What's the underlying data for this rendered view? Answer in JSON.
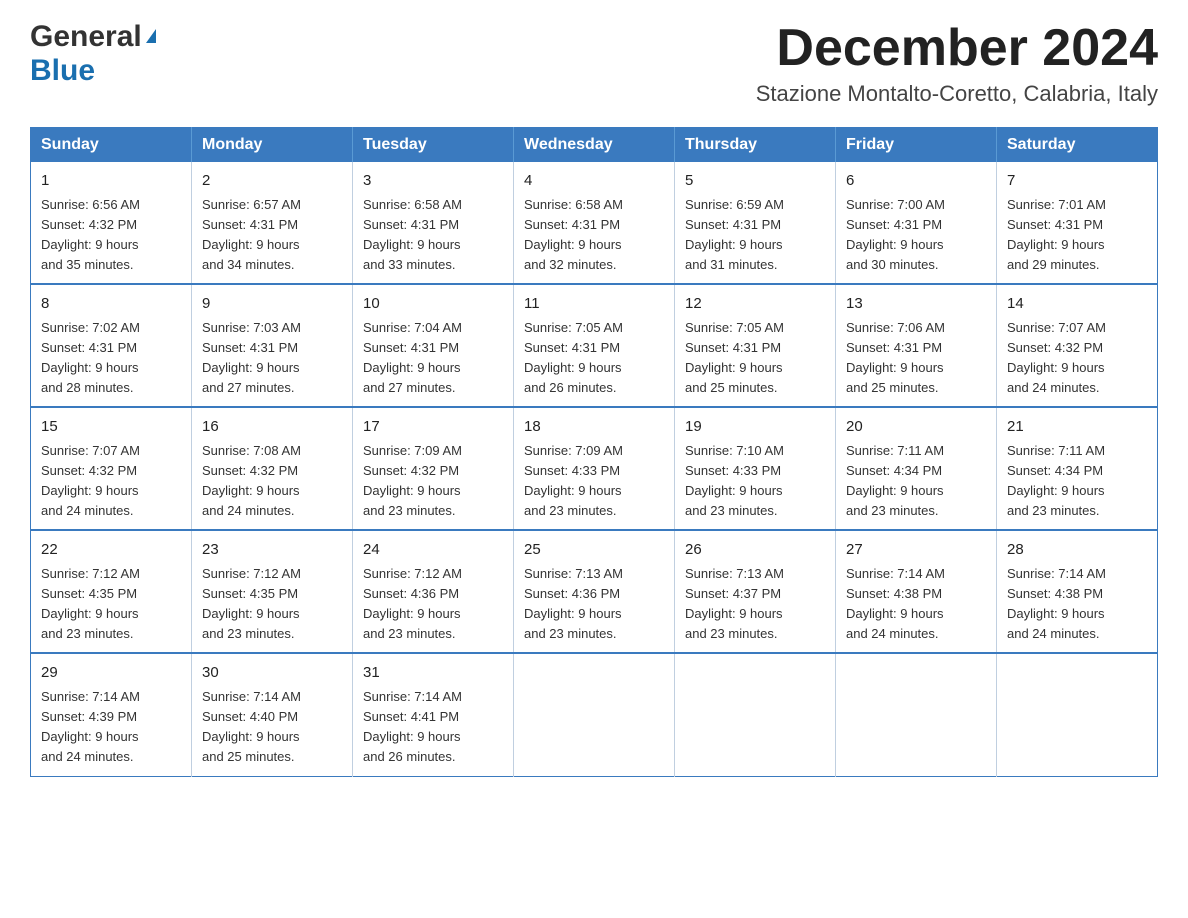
{
  "header": {
    "logo_line1": "General",
    "logo_line2": "Blue",
    "month_title": "December 2024",
    "location": "Stazione Montalto-Coretto, Calabria, Italy"
  },
  "days_of_week": [
    "Sunday",
    "Monday",
    "Tuesday",
    "Wednesday",
    "Thursday",
    "Friday",
    "Saturday"
  ],
  "weeks": [
    [
      {
        "day": "1",
        "sunrise": "6:56 AM",
        "sunset": "4:32 PM",
        "daylight": "9 hours and 35 minutes."
      },
      {
        "day": "2",
        "sunrise": "6:57 AM",
        "sunset": "4:31 PM",
        "daylight": "9 hours and 34 minutes."
      },
      {
        "day": "3",
        "sunrise": "6:58 AM",
        "sunset": "4:31 PM",
        "daylight": "9 hours and 33 minutes."
      },
      {
        "day": "4",
        "sunrise": "6:58 AM",
        "sunset": "4:31 PM",
        "daylight": "9 hours and 32 minutes."
      },
      {
        "day": "5",
        "sunrise": "6:59 AM",
        "sunset": "4:31 PM",
        "daylight": "9 hours and 31 minutes."
      },
      {
        "day": "6",
        "sunrise": "7:00 AM",
        "sunset": "4:31 PM",
        "daylight": "9 hours and 30 minutes."
      },
      {
        "day": "7",
        "sunrise": "7:01 AM",
        "sunset": "4:31 PM",
        "daylight": "9 hours and 29 minutes."
      }
    ],
    [
      {
        "day": "8",
        "sunrise": "7:02 AM",
        "sunset": "4:31 PM",
        "daylight": "9 hours and 28 minutes."
      },
      {
        "day": "9",
        "sunrise": "7:03 AM",
        "sunset": "4:31 PM",
        "daylight": "9 hours and 27 minutes."
      },
      {
        "day": "10",
        "sunrise": "7:04 AM",
        "sunset": "4:31 PM",
        "daylight": "9 hours and 27 minutes."
      },
      {
        "day": "11",
        "sunrise": "7:05 AM",
        "sunset": "4:31 PM",
        "daylight": "9 hours and 26 minutes."
      },
      {
        "day": "12",
        "sunrise": "7:05 AM",
        "sunset": "4:31 PM",
        "daylight": "9 hours and 25 minutes."
      },
      {
        "day": "13",
        "sunrise": "7:06 AM",
        "sunset": "4:31 PM",
        "daylight": "9 hours and 25 minutes."
      },
      {
        "day": "14",
        "sunrise": "7:07 AM",
        "sunset": "4:32 PM",
        "daylight": "9 hours and 24 minutes."
      }
    ],
    [
      {
        "day": "15",
        "sunrise": "7:07 AM",
        "sunset": "4:32 PM",
        "daylight": "9 hours and 24 minutes."
      },
      {
        "day": "16",
        "sunrise": "7:08 AM",
        "sunset": "4:32 PM",
        "daylight": "9 hours and 24 minutes."
      },
      {
        "day": "17",
        "sunrise": "7:09 AM",
        "sunset": "4:32 PM",
        "daylight": "9 hours and 23 minutes."
      },
      {
        "day": "18",
        "sunrise": "7:09 AM",
        "sunset": "4:33 PM",
        "daylight": "9 hours and 23 minutes."
      },
      {
        "day": "19",
        "sunrise": "7:10 AM",
        "sunset": "4:33 PM",
        "daylight": "9 hours and 23 minutes."
      },
      {
        "day": "20",
        "sunrise": "7:11 AM",
        "sunset": "4:34 PM",
        "daylight": "9 hours and 23 minutes."
      },
      {
        "day": "21",
        "sunrise": "7:11 AM",
        "sunset": "4:34 PM",
        "daylight": "9 hours and 23 minutes."
      }
    ],
    [
      {
        "day": "22",
        "sunrise": "7:12 AM",
        "sunset": "4:35 PM",
        "daylight": "9 hours and 23 minutes."
      },
      {
        "day": "23",
        "sunrise": "7:12 AM",
        "sunset": "4:35 PM",
        "daylight": "9 hours and 23 minutes."
      },
      {
        "day": "24",
        "sunrise": "7:12 AM",
        "sunset": "4:36 PM",
        "daylight": "9 hours and 23 minutes."
      },
      {
        "day": "25",
        "sunrise": "7:13 AM",
        "sunset": "4:36 PM",
        "daylight": "9 hours and 23 minutes."
      },
      {
        "day": "26",
        "sunrise": "7:13 AM",
        "sunset": "4:37 PM",
        "daylight": "9 hours and 23 minutes."
      },
      {
        "day": "27",
        "sunrise": "7:14 AM",
        "sunset": "4:38 PM",
        "daylight": "9 hours and 24 minutes."
      },
      {
        "day": "28",
        "sunrise": "7:14 AM",
        "sunset": "4:38 PM",
        "daylight": "9 hours and 24 minutes."
      }
    ],
    [
      {
        "day": "29",
        "sunrise": "7:14 AM",
        "sunset": "4:39 PM",
        "daylight": "9 hours and 24 minutes."
      },
      {
        "day": "30",
        "sunrise": "7:14 AM",
        "sunset": "4:40 PM",
        "daylight": "9 hours and 25 minutes."
      },
      {
        "day": "31",
        "sunrise": "7:14 AM",
        "sunset": "4:41 PM",
        "daylight": "9 hours and 26 minutes."
      },
      null,
      null,
      null,
      null
    ]
  ],
  "labels": {
    "sunrise": "Sunrise:",
    "sunset": "Sunset:",
    "daylight": "Daylight:"
  }
}
